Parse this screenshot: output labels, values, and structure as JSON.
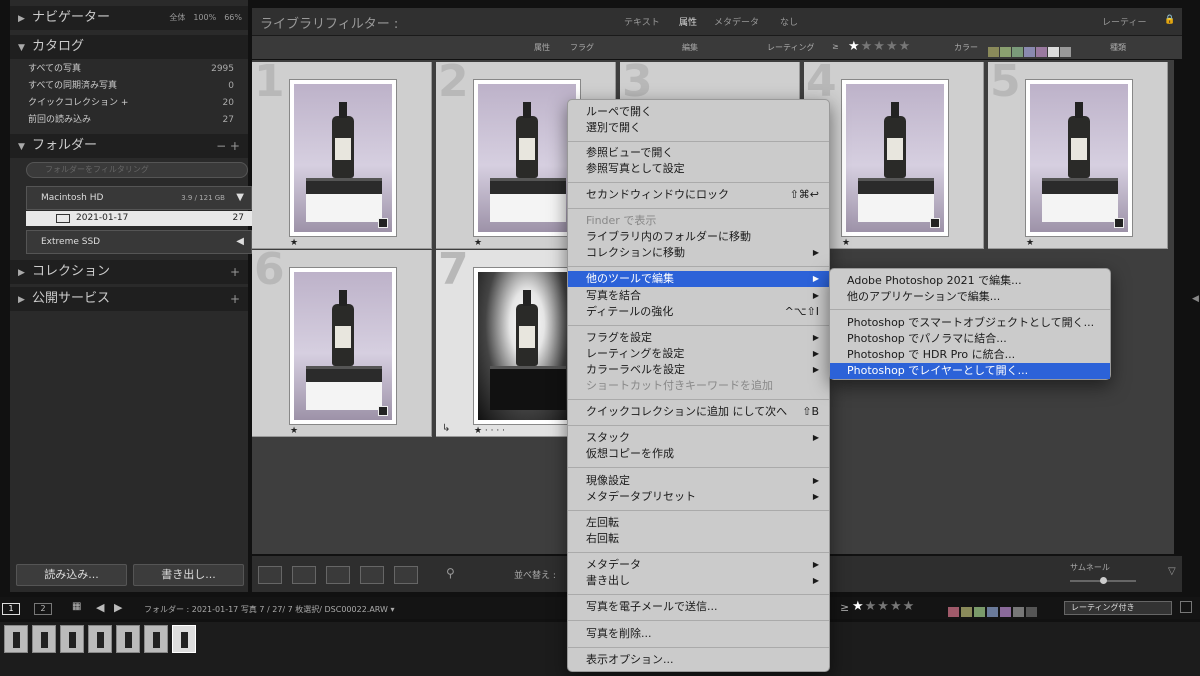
{
  "left": {
    "navigator": {
      "title": "ナビゲーター",
      "opts": [
        "全体",
        "100%",
        "66%"
      ]
    },
    "catalog": {
      "title": "カタログ",
      "items": [
        {
          "label": "すべての写真",
          "count": "2995"
        },
        {
          "label": "すべての同期済み写真",
          "count": "0"
        },
        {
          "label": "クイックコレクション +",
          "count": "20"
        },
        {
          "label": "前回の読み込み",
          "count": "27"
        }
      ]
    },
    "folders": {
      "title": "フォルダー",
      "actions": "− +",
      "search_placeholder": "フォルダーをフィルタリング",
      "volume1": {
        "name": "Macintosh HD",
        "size": "3.9 / 121 GB"
      },
      "folder": {
        "name": "2021-01-17",
        "count": "27"
      },
      "volume2": {
        "name": "Extreme SSD"
      }
    },
    "collections": {
      "title": "コレクション"
    },
    "publish": {
      "title": "公開サービス"
    },
    "import_label": "読み込み...",
    "export_label": "書き出し..."
  },
  "filter": {
    "title": "ライブラリフィルター :",
    "tabs": [
      "テキスト",
      "属性",
      "メタデータ",
      "なし"
    ],
    "right": "レーティー",
    "attr_label": "属性",
    "flag_label": "フラグ",
    "edit_label": "編集",
    "rating_label": "レーティング",
    "ge": "≥",
    "color_label": "カラー",
    "kind_label": "種類"
  },
  "grid": {
    "numbers": [
      "1",
      "2",
      "3",
      "4",
      "5",
      "6",
      "7"
    ]
  },
  "toolbar": {
    "sort_label": "並べ替え :",
    "thumb_label": "サムネール"
  },
  "filmstrip": {
    "page1": "1",
    "page2": "2",
    "path": "フォルダー : 2021-01-17  写真 7 / 27/ 7 枚選択/ DSC00022.ARW ▾",
    "ge": "≥",
    "sort": "レーティング付き"
  },
  "context_menu": {
    "items": [
      "ルーペで開く",
      "選別で開く",
      "参照ビューで開く",
      "参照写真として設定",
      "セカンドウィンドウにロック",
      "Finder で表示",
      "ライブラリ内のフォルダーに移動",
      "コレクションに移動",
      "他のツールで編集",
      "写真を結合",
      "ディテールの強化",
      "フラグを設定",
      "レーティングを設定",
      "カラーラベルを設定",
      "ショートカット付きキーワードを追加",
      "クイックコレクションに追加 にして次へ",
      "スタック",
      "仮想コピーを作成",
      "現像設定",
      "メタデータプリセット",
      "左回転",
      "右回転",
      "メタデータ",
      "書き出し",
      "写真を電子メールで送信...",
      "写真を削除...",
      "表示オプション..."
    ],
    "shortcuts": {
      "lock": "⇧⌘↩",
      "detail": "^⌥⇧I",
      "quick": "⇧B",
      "arrow": "▶"
    }
  },
  "submenu": {
    "items": [
      "Adobe Photoshop 2021 で編集...",
      "他のアプリケーションで編集...",
      "Photoshop でスマートオブジェクトとして開く...",
      "Photoshop でパノラマに結合...",
      "Photoshop で HDR Pro に統合...",
      "Photoshop でレイヤーとして開く..."
    ]
  },
  "colors": {
    "highlight": "#2c62d8"
  }
}
